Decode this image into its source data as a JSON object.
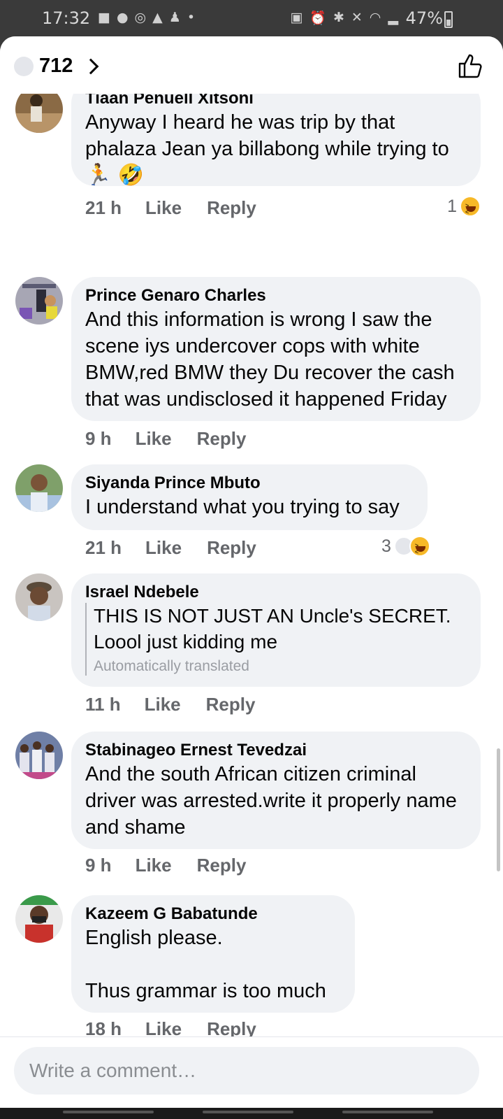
{
  "status_bar": {
    "time": "17:32",
    "battery": "47%",
    "notification_icons": [
      "chat-icon",
      "facebook-icon",
      "share-icon",
      "twitter-icon",
      "android-icon",
      "dot-icon"
    ],
    "system_icons": [
      "data-saver-icon",
      "alarm-icon",
      "bluetooth-icon",
      "mute-icon",
      "wifi-icon",
      "signal-icon"
    ]
  },
  "header": {
    "reaction_count": "712"
  },
  "comments": [
    {
      "name": "Tiaan Penuell Xitsoni",
      "text": "Anyway I heard he was trip by that phalaza Jean ya billabong while trying to",
      "emojis": [
        "🏃",
        "🤣"
      ],
      "time": "21 h",
      "like": "Like",
      "reply": "Reply",
      "reaction_count": "1"
    },
    {
      "name": "Prince Genaro Charles",
      "text": "And this information is wrong I saw the scene iys undercover cops with white BMW,red BMW they Du recover the cash that was undisclosed it happened Friday",
      "time": "9 h",
      "like": "Like",
      "reply": "Reply"
    },
    {
      "name": "Siyanda Prince Mbuto",
      "text": "I understand what you trying to say",
      "time": "21 h",
      "like": "Like",
      "reply": "Reply",
      "reaction_count": "3"
    },
    {
      "name": "Israel Ndebele",
      "text": "THIS IS NOT JUST AN Uncle's SECRET. Loool just kidding me",
      "translated_note": "Automatically translated",
      "time": "11 h",
      "like": "Like",
      "reply": "Reply"
    },
    {
      "name": "Stabinageo Ernest Tevedzai",
      "text": "And the south African citizen criminal driver was arrested.write it properly name and shame",
      "time": "9 h",
      "like": "Like",
      "reply": "Reply"
    },
    {
      "name": "Kazeem G Babatunde",
      "text": "English please.\n\nThus grammar is too much",
      "time": "18 h",
      "like": "Like",
      "reply": "Reply"
    }
  ],
  "composer": {
    "placeholder": "Write a comment…"
  },
  "colors": {
    "bubble": "#f0f2f5",
    "meta_text": "#65676b",
    "reaction_yellow": "#f7b928"
  }
}
